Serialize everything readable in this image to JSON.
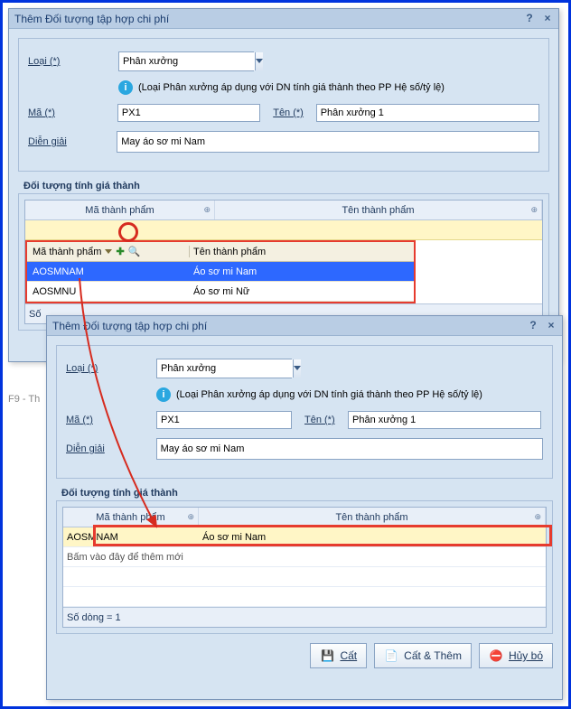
{
  "dialog1": {
    "title": "Thêm Đối tượng tập hợp chi phí",
    "help": "?",
    "close": "×",
    "loai_label": "Loại (*)",
    "loai_value": "Phân xưởng",
    "info_text": "(Loại Phân xưởng áp dụng với DN tính giá thành theo PP Hệ số/tỷ lệ)",
    "ma_label": "Mã (*)",
    "ma_value": "PX1",
    "ten_label": "Tên (*)",
    "ten_value": "Phân xưởng 1",
    "diengiai_label": "Diễn giải",
    "diengiai_value": "May áo sơ mi Nam",
    "group_label": "Đối tượng tính giá thành",
    "col1": "Mã thành phẩm",
    "col2": "Tên thành phẩm",
    "filter_col1": "Mã thành phẩm",
    "filter_col2": "Tên thành phẩm",
    "dd_rows": [
      {
        "code": "AOSMNAM",
        "name": "Áo sơ mi Nam",
        "selected": true
      },
      {
        "code": "AOSMNU",
        "name": "Áo sơ mi Nữ",
        "selected": false
      }
    ],
    "footer_rowcount_prefix": "Số",
    "f9_text": "F9 - Th"
  },
  "dialog2": {
    "title": "Thêm Đối tượng tập hợp chi phí",
    "help": "?",
    "close": "×",
    "loai_label": "Loại (*)",
    "loai_value": "Phân xưởng",
    "info_text": "(Loại Phân xưởng áp dụng với DN tính giá thành theo PP Hệ số/tỷ lệ)",
    "ma_label": "Mã (*)",
    "ma_value": "PX1",
    "ten_label": "Tên (*)",
    "ten_value": "Phân xưởng 1",
    "diengiai_label": "Diễn giải",
    "diengiai_value": "May áo sơ mi Nam",
    "group_label": "Đối tượng tính giá thành",
    "col1": "Mã thành phẩm",
    "col2": "Tên thành phẩm",
    "row1_code": "AOSMNAM",
    "row1_name": "Áo sơ mi Nam",
    "hint_text": "Bấm vào đây để thêm mới",
    "rowcount": "Số dòng = 1",
    "btn_save": "Cất",
    "btn_save_more": "Cất & Thêm",
    "btn_cancel": "Hủy bỏ"
  }
}
